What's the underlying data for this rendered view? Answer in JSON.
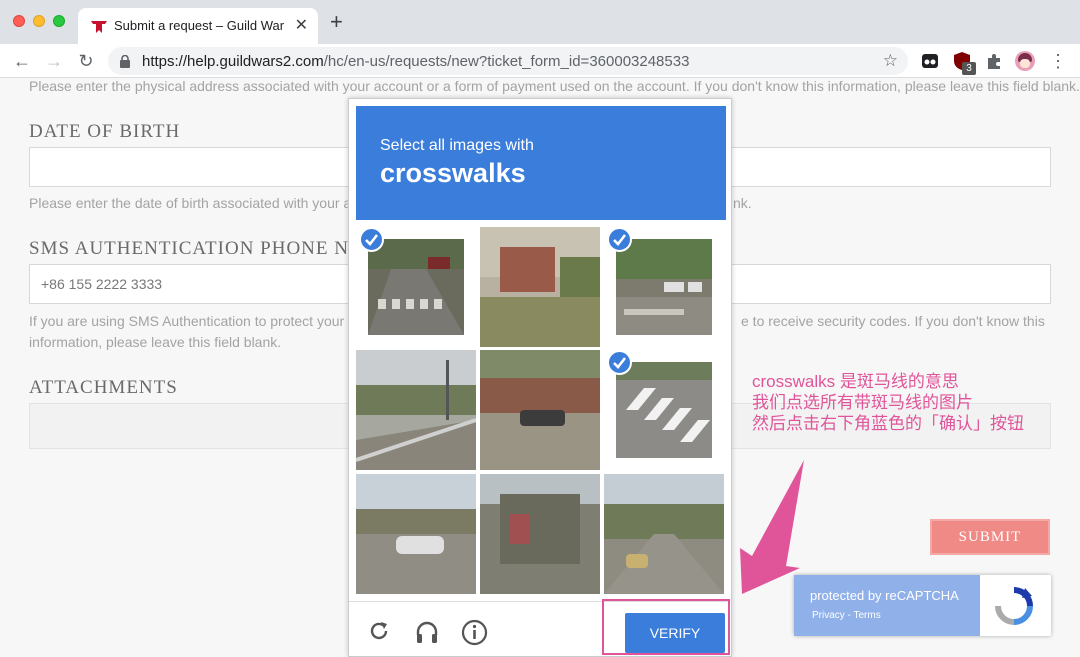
{
  "browser": {
    "tab_title": "Submit a request – Guild Wars",
    "url_host": "https://help.guildwars2.com",
    "url_path": "/hc/en-us/requests/new?ticket_form_id=360003248533",
    "extension_badge": "3"
  },
  "form": {
    "address_help": "Please enter the physical address associated with your account or a form of payment used on the account. If you don't know this information, please leave this field blank.",
    "dob_label": "DATE OF BIRTH",
    "dob_value": "",
    "dob_help_left": "Please enter the date of birth associated with your ac",
    "dob_help_right": "nk.",
    "sms_label": "SMS AUTHENTICATION PHONE N",
    "sms_value": "+86 155 2222 3333",
    "sms_help_line1_left": "If you are using SMS Authentication to protect your a",
    "sms_help_line1_right": "e to receive security codes. If you don't know this",
    "sms_help_line2": "information, please leave this field blank.",
    "attachments_label": "ATTACHMENTS",
    "submit_label": "SUBMIT"
  },
  "recaptcha_badge": {
    "text": "protected by reCAPTCHA",
    "links": "Privacy - Terms"
  },
  "captcha": {
    "instruction": "Select all images with",
    "target": "crosswalks",
    "verify_label": "VERIFY",
    "tiles": [
      {
        "selected": true
      },
      {
        "selected": false
      },
      {
        "selected": true
      },
      {
        "selected": false
      },
      {
        "selected": false
      },
      {
        "selected": true
      },
      {
        "selected": false
      },
      {
        "selected": false
      },
      {
        "selected": false
      }
    ]
  },
  "annotation": {
    "line1": "crosswalks 是斑马线的意思",
    "line2": "我们点选所有带斑马线的图片",
    "line3": "然后点击右下角蓝色的「确认」按钮",
    "color": "#e0559a"
  },
  "colors": {
    "captcha_blue": "#3b7ddb",
    "submit": "#f08a86"
  }
}
